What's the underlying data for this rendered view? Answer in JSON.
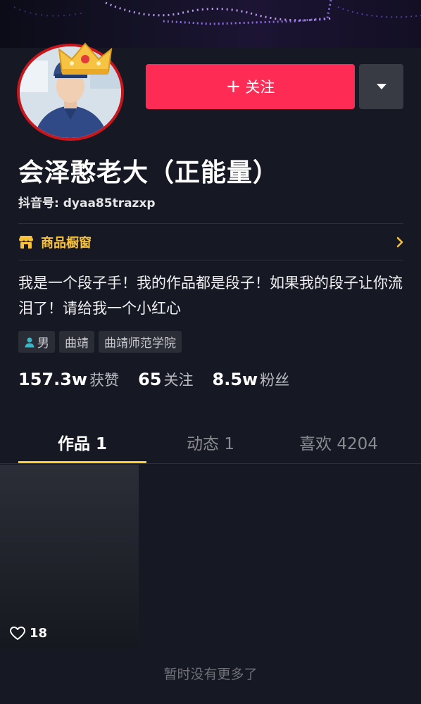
{
  "profile": {
    "name": "会泽憨老大（正能量）",
    "account_id": "抖音号: dyaa85trazxp",
    "bio": "我是一个段子手！我的作品都是段子！如果我的段子让你流泪了！请给我一个小红心"
  },
  "actions": {
    "follow_label": "关注",
    "more_icon": "caret-down-icon"
  },
  "shop": {
    "label": "商品橱窗"
  },
  "tags": [
    {
      "label": "男",
      "icon": "person-icon"
    },
    {
      "label": "曲靖"
    },
    {
      "label": "曲靖师范学院"
    }
  ],
  "stats": [
    {
      "value": "157.3w",
      "label": "获赞"
    },
    {
      "value": "65",
      "label": "关注"
    },
    {
      "value": "8.5w",
      "label": "粉丝"
    }
  ],
  "tabs": [
    {
      "label": "作品 1",
      "active": true
    },
    {
      "label": "动态 1",
      "active": false
    },
    {
      "label": "喜欢 4204",
      "active": false
    }
  ],
  "videos": [
    {
      "likes": "18"
    }
  ],
  "footer": {
    "no_more": "暂时没有更多了"
  },
  "colors": {
    "background": "#161823",
    "follow": "#fe2c55",
    "accent": "#facf2f",
    "shop": "#f9c23c"
  }
}
